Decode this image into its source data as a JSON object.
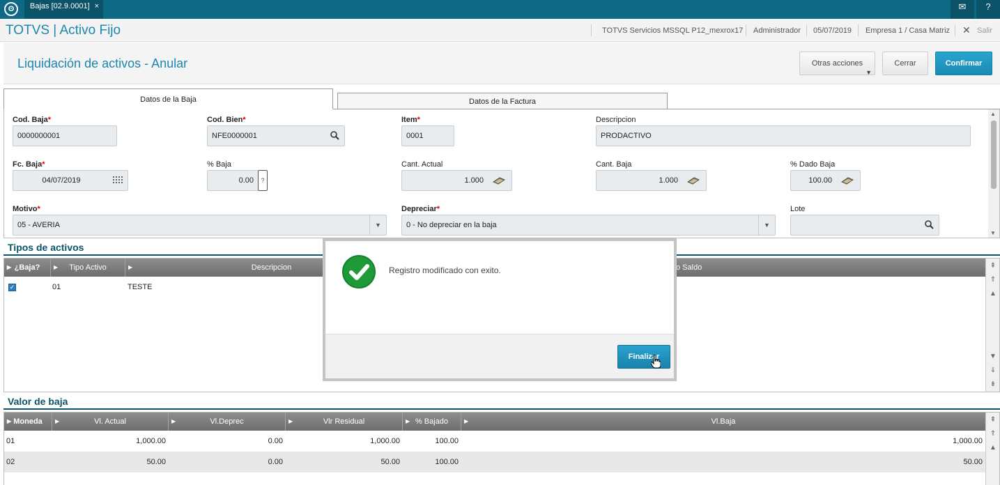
{
  "topbar": {
    "logo": "totvs-logo-icon",
    "tab_label": "Bajas [02.9.0001]",
    "tab_close": "×",
    "mail_icon": "mail-icon",
    "help_icon": "help-icon"
  },
  "header": {
    "title": "TOTVS | Activo Fijo",
    "server": "TOTVS Servicios MSSQL P12_mexrox17",
    "user": "Administrador",
    "date": "05/07/2019",
    "company": "Empresa 1 / Casa Matriz",
    "exit_label": "Salir",
    "exit_icon": "close-icon"
  },
  "page": {
    "title": "Liquidación de activos - Anular",
    "buttons": {
      "otras_acciones": "Otras acciones",
      "cerrar": "Cerrar",
      "confirmar": "Confirmar"
    }
  },
  "tabs": [
    {
      "label": "Datos de la Baja",
      "active": true
    },
    {
      "label": "Datos de la Factura",
      "active": false
    }
  ],
  "form": {
    "cod_baja": {
      "label": "Cod. Baja",
      "value": "0000000001",
      "required": true
    },
    "cod_bien": {
      "label": "Cod. Bien",
      "value": "NFE0000001",
      "required": true
    },
    "item": {
      "label": "Item",
      "value": "0001",
      "required": true
    },
    "descripcion": {
      "label": "Descripcion",
      "value": "PRODACTIVO"
    },
    "fc_baja": {
      "label": "Fc. Baja",
      "value": "04/07/2019",
      "required": true
    },
    "pct_baja": {
      "label": "% Baja",
      "value": "0.00",
      "help": "?"
    },
    "cant_actual": {
      "label": "Cant. Actual",
      "value": "1.000"
    },
    "cant_baja": {
      "label": "Cant. Baja",
      "value": "1.000"
    },
    "pct_dado_baja": {
      "label": "% Dado Baja",
      "value": "100.00"
    },
    "motivo": {
      "label": "Motivo",
      "value": "05 - AVERIA",
      "required": true
    },
    "depreciar": {
      "label": "Depreciar",
      "value": "0 - No depreciar en la baja",
      "required": true
    },
    "lote": {
      "label": "Lote",
      "value": ""
    },
    "required_mark": "*"
  },
  "tipos_activos": {
    "title": "Tipos de activos",
    "columns": [
      "¿Baja?",
      "Tipo Activo",
      "Descripcion",
      "o Saldo"
    ],
    "rows": [
      {
        "checked": true,
        "tipo": "01",
        "descripcion": "TESTE"
      }
    ]
  },
  "valor_baja": {
    "title": "Valor de baja",
    "columns": [
      "Moneda",
      "Vl. Actual",
      "Vl.Deprec",
      "Vlr Residual",
      "% Bajado",
      "Vl.Baja"
    ],
    "rows": [
      {
        "moneda": "01",
        "actual": "1,000.00",
        "deprec": "0.00",
        "residual": "1,000.00",
        "bajado": "100.00",
        "baja": "1,000.00"
      },
      {
        "moneda": "02",
        "actual": "50.00",
        "deprec": "0.00",
        "residual": "50.00",
        "bajado": "100.00",
        "baja": "50.00"
      }
    ]
  },
  "dialog": {
    "message": "Registro modificado con exito.",
    "button": "Finalizar",
    "icon": "success-check-icon"
  },
  "colors": {
    "topbar": "#0e6a84",
    "accent": "#1b86b0",
    "section": "#0a5368",
    "success": "#1e9a37"
  }
}
